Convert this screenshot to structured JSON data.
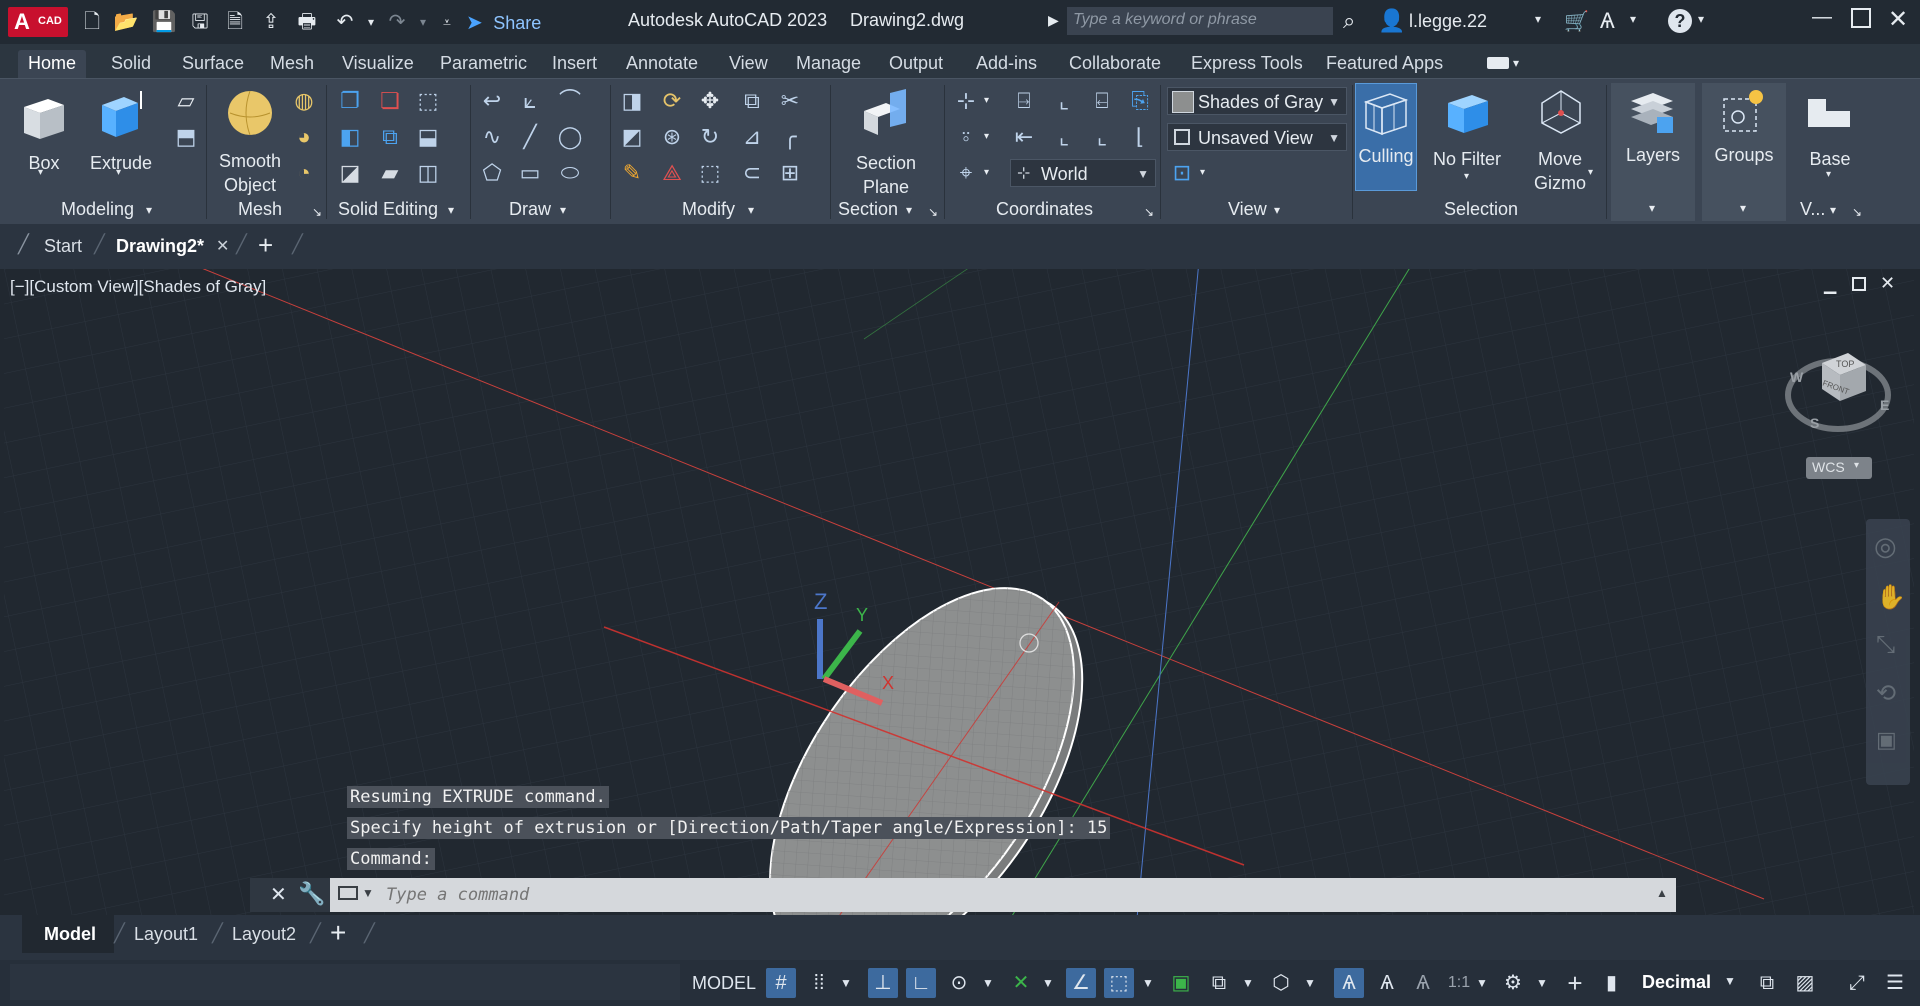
{
  "app": {
    "badge_main": "A",
    "badge_sub": "CAD",
    "share_label": "Share",
    "title": "Autodesk AutoCAD 2023",
    "filename": "Drawing2.dwg",
    "search_placeholder": "Type a keyword or phrase",
    "user": "l.legge.22"
  },
  "ribbon_tabs": [
    "Home",
    "Solid",
    "Surface",
    "Mesh",
    "Visualize",
    "Parametric",
    "Insert",
    "Annotate",
    "View",
    "Manage",
    "Output",
    "Add-ins",
    "Collaborate",
    "Express Tools",
    "Featured Apps"
  ],
  "ribbon": {
    "box": "Box",
    "extrude": "Extrude",
    "smooth_object_1": "Smooth",
    "smooth_object_2": "Object",
    "section_plane_1": "Section",
    "section_plane_2": "Plane",
    "visual_style": "Shades of Gray",
    "saved_view": "Unsaved View",
    "ucs": "World",
    "culling": "Culling",
    "no_filter": "No Filter",
    "move_gizmo_1": "Move",
    "move_gizmo_2": "Gizmo",
    "layers": "Layers",
    "groups": "Groups",
    "base": "Base",
    "panels": {
      "modeling": "Modeling",
      "mesh": "Mesh",
      "solid_editing": "Solid Editing",
      "draw": "Draw",
      "modify": "Modify",
      "section": "Section",
      "coordinates": "Coordinates",
      "view": "View",
      "selection": "Selection",
      "view_short": "V..."
    }
  },
  "file_tabs": {
    "start": "Start",
    "drawing": "Drawing2*",
    "add": "+"
  },
  "viewport": {
    "label": "[−][Custom View][Shades of Gray]",
    "viewcube_top": "TOP",
    "viewcube_front": "FRONT",
    "compass_w": "W",
    "compass_s": "S",
    "compass_e": "E",
    "wcs": "WCS",
    "axis_z": "Z",
    "axis_y": "Y",
    "axis_x": "X"
  },
  "command_history": [
    "Resuming EXTRUDE command.",
    "Specify height of extrusion or [Direction/Path/Taper angle/Expression]: 15",
    "Command:"
  ],
  "command_input_placeholder": "Type a command",
  "layout_tabs": [
    "Model",
    "Layout1",
    "Layout2"
  ],
  "status": {
    "model": "MODEL",
    "scale": "1:1",
    "units": "Decimal"
  },
  "colors": {
    "accent": "#2f7bd6",
    "x_axis": "#d0332f",
    "y_axis": "#3cb54a",
    "z_axis": "#4c76c9",
    "solid": "#8d8f8f"
  }
}
